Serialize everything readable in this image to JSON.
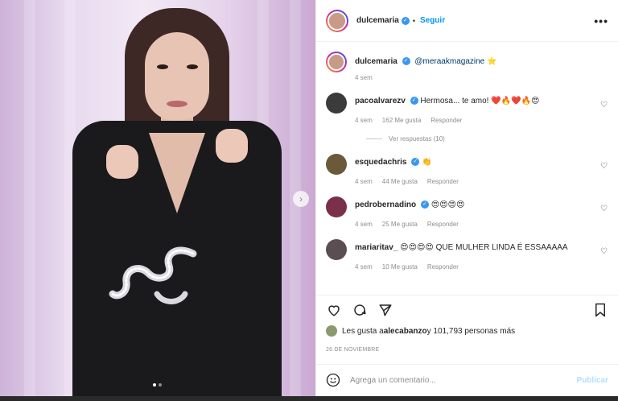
{
  "post": {
    "author": "dulcemaria",
    "follow_label": "Seguir",
    "separator": "•",
    "more": "•••",
    "caption_mention": "@meraakmagazine ⭐",
    "caption_time": "4 sem",
    "carousel": {
      "dots": 2,
      "active": 0
    }
  },
  "comments": [
    {
      "user": "pacoalvarezv",
      "verified": true,
      "text": "Hermosa... te amo! ❤️🔥❤️🔥😍",
      "time": "4 sem",
      "likes": "162 Me gusta",
      "reply": "Responder",
      "avatar_color": "#3b3b3b",
      "view_replies": "Ver respuestas (10)"
    },
    {
      "user": "esquedachris",
      "verified": true,
      "text": "👏",
      "time": "4 sem",
      "likes": "44 Me gusta",
      "reply": "Responder",
      "avatar_color": "#6b5a3a"
    },
    {
      "user": "pedrobernadino",
      "verified": true,
      "text": "😍😍😍😍",
      "time": "4 sem",
      "likes": "25 Me gusta",
      "reply": "Responder",
      "avatar_color": "#7a2f4a"
    },
    {
      "user": "mariaritav_",
      "verified": false,
      "text": "😍😍😍😍 QUE MULHER LINDA É ESSAAAAA",
      "time": "4 sem",
      "likes": "10 Me gusta",
      "reply": "Responder",
      "avatar_color": "#5a4e52"
    }
  ],
  "likes_line": {
    "prefix": "Les gusta a ",
    "user": "alecabanzo",
    "suffix": " y 101,793 personas más"
  },
  "date": "26 DE NOVIEMBRE",
  "add_comment": {
    "placeholder": "Agrega un comentario...",
    "publish": "Publicar"
  },
  "colors": {
    "link": "#0095f6",
    "publish_disabled": "#b2dffc",
    "verified": "#3897f0"
  }
}
